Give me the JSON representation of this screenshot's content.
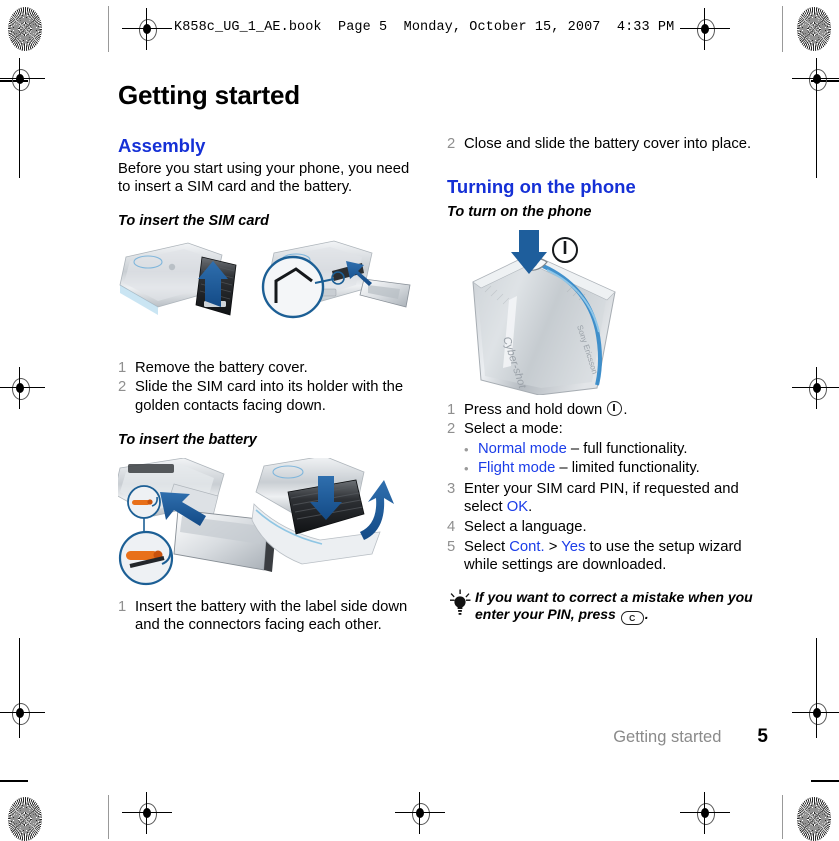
{
  "print_header": {
    "text": "K858c_UG_1_AE.book  Page 5  Monday, October 15, 2007  4:33 PM"
  },
  "page": {
    "title": "Getting started",
    "footer_section": "Getting started",
    "footer_page": "5"
  },
  "colors": {
    "heading_blue": "#1530d6",
    "link_blue": "#1a3ce8",
    "list_number_gray": "#8f8f8f",
    "footer_gray": "#8a8a8a"
  },
  "left_column": {
    "section_heading": "Assembly",
    "intro": "Before you start using your phone, you need to insert a SIM card and the battery.",
    "procedure_1_heading": "To insert the SIM card",
    "figure_1_alt": "Phone back cover being lifted off and SIM card sliding into its holder",
    "steps_1": [
      {
        "num": "1",
        "text": "Remove the battery cover."
      },
      {
        "num": "2",
        "text": "Slide the SIM card into its holder with the golden contacts facing down."
      }
    ],
    "procedure_2_heading": "To insert the battery",
    "figure_2_alt": "Battery sliding into the phone and the battery cover being closed",
    "steps_2": [
      {
        "num": "1",
        "text": "Insert the battery with the label side down and the connectors facing each other."
      }
    ]
  },
  "right_column": {
    "steps_top": [
      {
        "num": "2",
        "text": "Close and slide the battery cover into place."
      }
    ],
    "section_heading": "Turning on the phone",
    "procedure_heading": "To turn on the phone",
    "figure_alt": "Sony Ericsson Cyber-shot phone with arrow pointing at the power key on top",
    "figure_labels": {
      "phone_brand": "Cyber-shot",
      "phone_side": "Sony Ericsson"
    },
    "steps": [
      {
        "num": "1",
        "parts": [
          {
            "type": "text",
            "value": "Press and hold down "
          },
          {
            "type": "icon",
            "value": "power-key-icon"
          },
          {
            "type": "text",
            "value": "."
          }
        ]
      },
      {
        "num": "2",
        "parts": [
          {
            "type": "text",
            "value": "Select a mode:"
          }
        ],
        "bullets": [
          {
            "link": "Normal mode",
            "rest": " – full functionality."
          },
          {
            "link": "Flight mode",
            "rest": " – limited functionality."
          }
        ]
      },
      {
        "num": "3",
        "parts": [
          {
            "type": "text",
            "value": "Enter your SIM card PIN, if requested and select "
          },
          {
            "type": "link",
            "value": "OK"
          },
          {
            "type": "text",
            "value": "."
          }
        ]
      },
      {
        "num": "4",
        "parts": [
          {
            "type": "text",
            "value": "Select a language."
          }
        ]
      },
      {
        "num": "5",
        "parts": [
          {
            "type": "text",
            "value": "Select "
          },
          {
            "type": "link",
            "value": "Cont."
          },
          {
            "type": "text",
            "value": " > "
          },
          {
            "type": "link",
            "value": "Yes"
          },
          {
            "type": "text",
            "value": " to use the setup wizard while settings are downloaded."
          }
        ]
      }
    ],
    "tip": {
      "icon": "lightbulb-icon",
      "text_before": "If you want to correct a mistake when you enter your PIN, press ",
      "key_label": "C",
      "text_after": "."
    }
  },
  "step_text": {
    "l1s1": "Remove the battery cover.",
    "l1s2": "Slide the SIM card into its holder with the golden contacts facing down.",
    "l2s1": "Insert the battery with the label side down and the connectors facing each other.",
    "r0s2": "Close and slide the battery cover into place.",
    "r1": "Press and hold down ",
    "r1_end": ".",
    "r2": "Select a mode:",
    "r2b1_link": "Normal mode",
    "r2b1_rest": " – full functionality.",
    "r2b2_link": "Flight mode",
    "r2b2_rest": " – limited functionality.",
    "r3a": "Enter your SIM card PIN, if requested and select ",
    "r3_link": "OK",
    "r3b": ".",
    "r4": "Select a language.",
    "r5a": "Select ",
    "r5_link1": "Cont.",
    "r5_mid": " > ",
    "r5_link2": "Yes",
    "r5b": " to use the setup wizard while settings are downloaded."
  },
  "numbers": {
    "one": "1",
    "two": "2",
    "three": "3",
    "four": "4",
    "five": "5",
    "bullet": "•"
  }
}
